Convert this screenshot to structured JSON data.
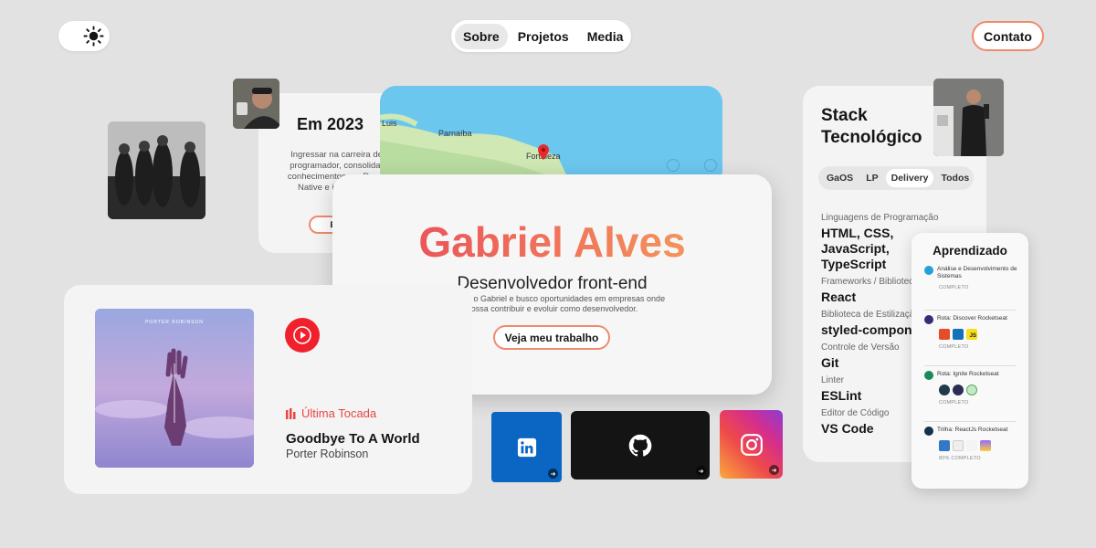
{
  "nav": {
    "items": [
      "Sobre",
      "Projetos",
      "Media"
    ],
    "active": "Sobre",
    "contact_label": "Contato"
  },
  "year_card": {
    "title": "Em 2023",
    "description": "Ingressar na carreira de programador, consolidar conhecimentos em React Native e iniciar back",
    "button_label": "Em B"
  },
  "map": {
    "places": [
      "Luis",
      "Parnaíba",
      "Fortaleza"
    ]
  },
  "hero": {
    "name": "Gabriel Alves",
    "role": "Desenvolvedor front-end",
    "bio": "Olá! Sou o Gabriel e busco oportunidades em empresas onde possa contribuir e evoluir como desenvolvedor.",
    "cta": "Veja meu trabalho"
  },
  "music": {
    "album_artist_text": "PORTER ROBINSON",
    "status": "Última Tocada",
    "song": "Goodbye To A World",
    "artist": "Porter Robinson"
  },
  "social": {
    "items": [
      "linkedin",
      "github",
      "instagram"
    ]
  },
  "stack": {
    "title_line1": "Stack",
    "title_line2": "Tecnológico",
    "tabs": [
      "GaOS",
      "LP",
      "Delivery",
      "Todos"
    ],
    "active_tab": "Delivery",
    "rows": [
      {
        "label": "Linguagens de Programação",
        "value": "HTML, CSS, JavaScript, TypeScript"
      },
      {
        "label": "Frameworks / Bibliotecas",
        "value": "React"
      },
      {
        "label": "Biblioteca de Estilização",
        "value": "styled-components"
      },
      {
        "label": "Controle de Versão",
        "value": "Git"
      },
      {
        "label": "Linter",
        "value": "ESLint"
      },
      {
        "label": "Editor de Código",
        "value": "VS Code"
      }
    ]
  },
  "learning": {
    "title": "Aprendizado",
    "items": [
      {
        "name": "Análise e Desenvolvimento de Sistemas",
        "status": "COMPLETO",
        "color": "#27a0d8"
      },
      {
        "name": "Rota: Discover Rocketseat",
        "status": "COMPLETO",
        "color": "#3a2a7a",
        "badges": [
          "HTML5",
          "CSS3",
          "JS"
        ]
      },
      {
        "name": "Rota: Ignite Rocketseat",
        "status": "COMPLETO",
        "color": "#1b8a5a"
      },
      {
        "name": "Trilha: ReactJs Rocketseat",
        "status": "80% COMPLETO",
        "color": "#16324a"
      }
    ]
  },
  "colors": {
    "accent_border": "#f08a6c",
    "gradient_start": "#e8425a",
    "gradient_end": "#f5a85c",
    "linkedin": "#0a66c2",
    "youtube_music": "#f0202d"
  }
}
